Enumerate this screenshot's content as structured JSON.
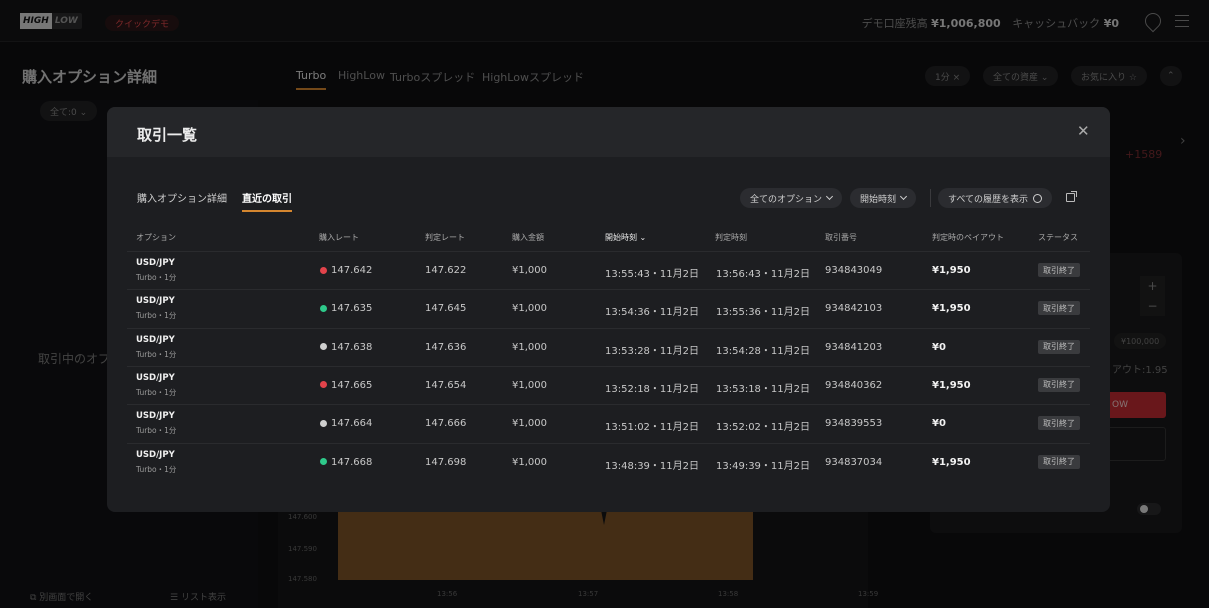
{
  "topbar": {
    "logo_high": "HIGH",
    "logo_low": "LOW",
    "demo_badge": "クイックデモ",
    "balance_label": "デモ口座残高",
    "balance_value": "¥1,006,800",
    "cashback_label": "キャッシュバック",
    "cashback_value": "¥0",
    "icons": [
      "pin-icon",
      "menu-icon"
    ]
  },
  "background": {
    "title": "購入オプション詳細",
    "tabs": [
      "Turbo",
      "HighLow",
      "Turboスプレッド",
      "HighLowスプレッド"
    ],
    "chips": [
      "1分 ×",
      "全ての資産 ⌄",
      "お気に入り ☆"
    ],
    "filter": "全て:0 ⌄",
    "trading_label": "取引中のオプ",
    "open_new_window": "別画面で開く",
    "list_view": "リスト表示",
    "red_number": "+1589",
    "amount_chip": "¥100,000",
    "payout_text": "アウト:1.95",
    "high_btn": "OW",
    "chart_y_labels": [
      "147.600",
      "147.590",
      "147.580"
    ],
    "chart_x_labels": [
      "13:56",
      "13:57",
      "13:58",
      "13:59"
    ]
  },
  "modal": {
    "title": "取引一覧",
    "tabs": {
      "details": "購入オプション詳細",
      "recent": "直近の取引"
    },
    "filters": {
      "options": "全てのオプション",
      "start_time": "開始時刻",
      "show_all_history": "すべての履歴を表示"
    },
    "columns": {
      "option": "オプション",
      "buy_rate": "購入レート",
      "judge_rate": "判定レート",
      "amount": "購入金額",
      "start_time": "開始時刻",
      "judge_time": "判定時刻",
      "trade_no": "取引番号",
      "payout": "判定時のペイアウト",
      "status": "ステータス"
    },
    "rows": [
      {
        "pair": "USD/JPY",
        "type": "Turbo・1分",
        "dir_color": "#e2434b",
        "buy_rate": "147.642",
        "judge_rate": "147.622",
        "amount": "¥1,000",
        "start": "13:55:43・11月2日",
        "judge": "13:56:43・11月2日",
        "trade_no": "934843049",
        "payout": "¥1,950",
        "status": "取引終了"
      },
      {
        "pair": "USD/JPY",
        "type": "Turbo・1分",
        "dir_color": "#2ec98a",
        "buy_rate": "147.635",
        "judge_rate": "147.645",
        "amount": "¥1,000",
        "start": "13:54:36・11月2日",
        "judge": "13:55:36・11月2日",
        "trade_no": "934842103",
        "payout": "¥1,950",
        "status": "取引終了"
      },
      {
        "pair": "USD/JPY",
        "type": "Turbo・1分",
        "dir_color": "#cfcfcf",
        "buy_rate": "147.638",
        "judge_rate": "147.636",
        "amount": "¥1,000",
        "start": "13:53:28・11月2日",
        "judge": "13:54:28・11月2日",
        "trade_no": "934841203",
        "payout": "¥0",
        "status": "取引終了"
      },
      {
        "pair": "USD/JPY",
        "type": "Turbo・1分",
        "dir_color": "#e2434b",
        "buy_rate": "147.665",
        "judge_rate": "147.654",
        "amount": "¥1,000",
        "start": "13:52:18・11月2日",
        "judge": "13:53:18・11月2日",
        "trade_no": "934840362",
        "payout": "¥1,950",
        "status": "取引終了"
      },
      {
        "pair": "USD/JPY",
        "type": "Turbo・1分",
        "dir_color": "#cfcfcf",
        "buy_rate": "147.664",
        "judge_rate": "147.666",
        "amount": "¥1,000",
        "start": "13:51:02・11月2日",
        "judge": "13:52:02・11月2日",
        "trade_no": "934839553",
        "payout": "¥0",
        "status": "取引終了"
      },
      {
        "pair": "USD/JPY",
        "type": "Turbo・1分",
        "dir_color": "#2ec98a",
        "buy_rate": "147.668",
        "judge_rate": "147.698",
        "amount": "¥1,000",
        "start": "13:48:39・11月2日",
        "judge": "13:49:39・11月2日",
        "trade_no": "934837034",
        "payout": "¥1,950",
        "status": "取引終了"
      }
    ]
  },
  "colors": {
    "accent": "#d4862f",
    "sell": "#e2434b",
    "buy": "#2ec98a",
    "neutral": "#cfcfcf"
  }
}
